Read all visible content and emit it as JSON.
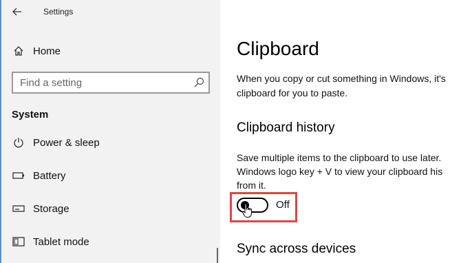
{
  "window": {
    "title": "Settings"
  },
  "sidebar": {
    "home_label": "Home",
    "search_placeholder": "Find a setting",
    "section_label": "System",
    "items": [
      {
        "label": "Power & sleep",
        "icon": "power-icon"
      },
      {
        "label": "Battery",
        "icon": "battery-icon"
      },
      {
        "label": "Storage",
        "icon": "storage-icon"
      },
      {
        "label": "Tablet mode",
        "icon": "tablet-mode-icon"
      }
    ]
  },
  "main": {
    "title": "Clipboard",
    "intro_line1": "When you copy or cut something in Windows, it's",
    "intro_line2": "clipboard for you to paste.",
    "history_heading": "Clipboard history",
    "history_desc_line1": "Save multiple items to the clipboard to use later.",
    "history_desc_line2": "Windows logo key + V to view your clipboard his",
    "history_desc_line3": "from it.",
    "toggle_state": "Off",
    "sync_heading": "Sync across devices"
  },
  "colors": {
    "sidebar_bg": "#f2f2f2",
    "highlight_border": "#e04343",
    "window_edge": "#5f8fc4"
  }
}
